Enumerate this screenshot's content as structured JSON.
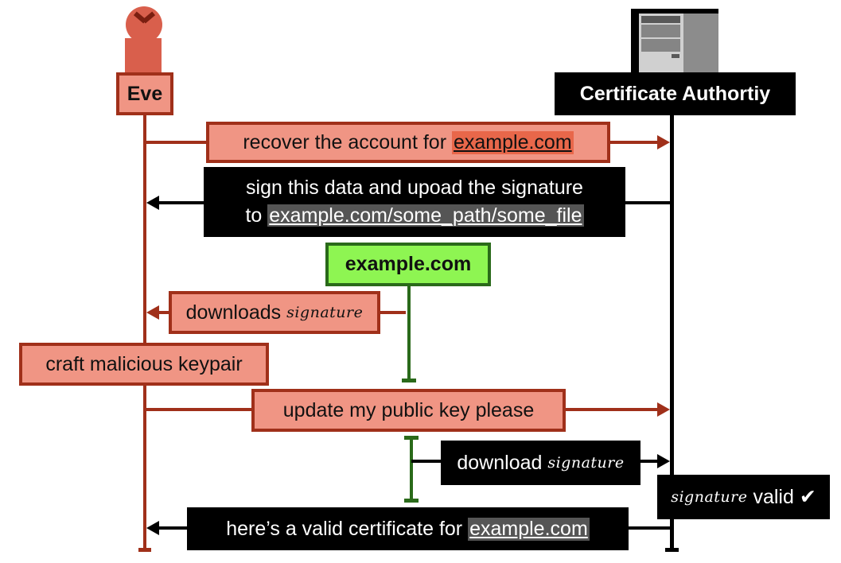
{
  "diagram": {
    "title": "",
    "colors": {
      "eve_dark": "#a0301a",
      "eve_fill": "#f09584",
      "eve_icon": "#d95f4c",
      "highlight_red": "#e8674a",
      "ca_black": "#000000",
      "highlight_gray": "#555555",
      "site_green_fill": "#8ef552",
      "site_green_border": "#2a6a1a"
    },
    "actors": {
      "eve": {
        "label": "Eve",
        "icon": "person-icon"
      },
      "ca": {
        "label": "Certificate Authortiy",
        "icon": "server-icon"
      },
      "site": {
        "label": "example.com"
      }
    },
    "messages": {
      "m1": {
        "text": "recover the account for ",
        "link": "example.com",
        "from": "Eve",
        "to": "Certificate Authortiy"
      },
      "m2": {
        "line1": "sign this data and upoad the signature",
        "line2_prefix": "to ",
        "link": "example.com/some_path/some_file",
        "from": "Certificate Authortiy",
        "to": "Eve"
      },
      "m3": {
        "text": "downloads ",
        "script": "signature",
        "from": "example.com",
        "to": "Eve"
      },
      "m4": {
        "text": "craft malicious keypair",
        "actor": "Eve"
      },
      "m5": {
        "text": "update my public key please",
        "from": "Eve",
        "to": "Certificate Authortiy"
      },
      "m6": {
        "text": "download ",
        "script": "signature",
        "from": "example.com",
        "to": "Certificate Authortiy"
      },
      "m7": {
        "script": "signature",
        "text": " valid ",
        "check": "✔",
        "actor": "Certificate Authortiy"
      },
      "m8": {
        "text": "here’s a valid certificate for ",
        "link": "example.com",
        "from": "Certificate Authortiy",
        "to": "Eve"
      }
    }
  }
}
